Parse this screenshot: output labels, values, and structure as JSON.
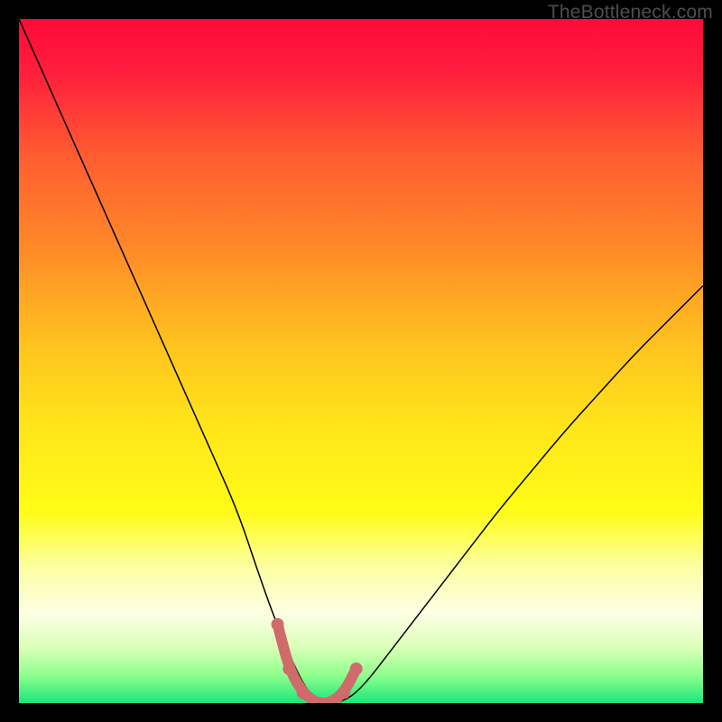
{
  "watermark": {
    "text": "TheBottleneck.com"
  },
  "chart_data": {
    "type": "line",
    "title": "",
    "xlabel": "",
    "ylabel": "",
    "xlim": [
      0,
      100
    ],
    "ylim": [
      0,
      100
    ],
    "grid": false,
    "background_gradient": {
      "stops": [
        {
          "pos": 0.0,
          "color": "#ff0a3a"
        },
        {
          "pos": 0.08,
          "color": "#ff1f3c"
        },
        {
          "pos": 0.2,
          "color": "#ff5d30"
        },
        {
          "pos": 0.33,
          "color": "#ff8828"
        },
        {
          "pos": 0.48,
          "color": "#ffc41f"
        },
        {
          "pos": 0.6,
          "color": "#ffe619"
        },
        {
          "pos": 0.72,
          "color": "#fffc16"
        },
        {
          "pos": 0.8,
          "color": "#fcffa0"
        },
        {
          "pos": 0.87,
          "color": "#fdffe6"
        },
        {
          "pos": 0.92,
          "color": "#d9ffb5"
        },
        {
          "pos": 0.96,
          "color": "#8dff8d"
        },
        {
          "pos": 1.0,
          "color": "#19e77a"
        }
      ]
    },
    "series": [
      {
        "name": "bottleneck-curve",
        "color": "#000000",
        "width": 1.5,
        "x": [
          0,
          4,
          8,
          12,
          16,
          20,
          24,
          28,
          32,
          35,
          37.5,
          40,
          42,
          44,
          47,
          50,
          55,
          60,
          65,
          70,
          75,
          80,
          85,
          90,
          95,
          100
        ],
        "y": [
          100,
          91,
          82,
          73,
          64,
          55,
          46,
          37,
          28,
          19,
          12,
          6,
          2,
          0,
          0,
          2,
          8.5,
          15,
          21.5,
          28,
          34,
          40,
          45.5,
          51,
          56,
          61
        ]
      }
    ],
    "highlight_band": {
      "name": "optimal-zone",
      "color": "#d06b6b",
      "width": 12,
      "dot_radius": 7,
      "x": [
        37.8,
        39.5,
        41.5,
        43.5,
        45.5,
        47.5,
        49.3
      ],
      "y": [
        11.5,
        5.0,
        1.5,
        0.0,
        0.0,
        1.5,
        5.0
      ]
    }
  }
}
